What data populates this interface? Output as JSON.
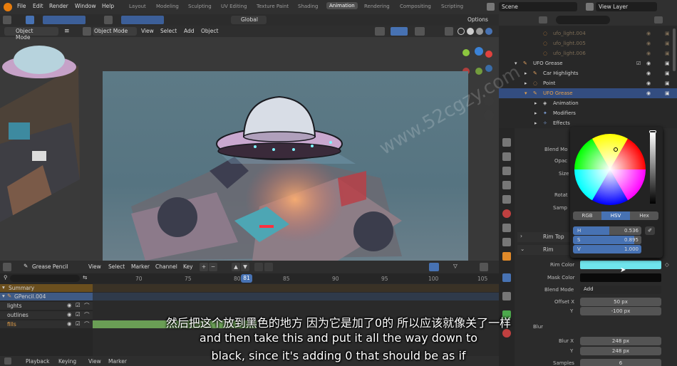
{
  "topbar": {
    "menus": [
      "File",
      "Edit",
      "Render",
      "Window",
      "Help"
    ],
    "workspaces": [
      "Layout",
      "Modeling",
      "Sculpting",
      "UV Editing",
      "Texture Paint",
      "Shading",
      "Animation",
      "Rendering",
      "Compositing",
      "Scripting"
    ],
    "active_workspace": "Animation",
    "scene": "Scene",
    "view_layer": "View Layer"
  },
  "left_panel": {
    "mode": "Object Mode"
  },
  "viewport_header": {
    "mode": "Object Mode",
    "menus": [
      "View",
      "Select",
      "Add",
      "Object"
    ],
    "transform": "Global",
    "options": "Options"
  },
  "outliner": {
    "rows": [
      {
        "label": "ufo_light.004",
        "muted": true
      },
      {
        "label": "ufo_light.005",
        "muted": true
      },
      {
        "label": "ufo_light.006",
        "muted": true
      },
      {
        "label": "UFO Grease",
        "muted": false
      },
      {
        "label": "Car Highlights",
        "muted": false
      },
      {
        "label": "Point",
        "muted": false
      },
      {
        "label": "UFO Grease",
        "muted": false,
        "selected": true
      },
      {
        "label": "Animation",
        "muted": false
      },
      {
        "label": "Modifiers",
        "muted": false
      },
      {
        "label": "Effects",
        "muted": false
      }
    ]
  },
  "properties": {
    "labels": [
      "Blend Mo",
      "Opac",
      "Size",
      "Rotat",
      "Samp"
    ],
    "rim_top": "Rim Top",
    "rim": "Rim",
    "rim_color_label": "Rim Color",
    "mask_color_label": "Mask Color",
    "blend_mode_label": "Blend Mode",
    "blend_mode_value": "Add",
    "offset_x_label": "Offset X",
    "offset_x": "50 px",
    "offset_y_label": "Y",
    "offset_y": "-100 px",
    "blur_label": "Blur",
    "blur_x_label": "Blur X",
    "blur_x": "248 px",
    "blur_y_label": "Y",
    "blur_y": "248 px",
    "samples_label": "Samples",
    "samples": "6",
    "rim_color_hex": "#6fe4ec"
  },
  "color_picker": {
    "modes": [
      "RGB",
      "HSV",
      "Hex"
    ],
    "active_mode": "HSV",
    "h_label": "H",
    "h": "0.536",
    "s_label": "S",
    "s": "0.895",
    "v_label": "V",
    "v": "1.000"
  },
  "timeline": {
    "editor": "Grease Pencil",
    "menus": [
      "View",
      "Select",
      "Marker",
      "Channel",
      "Key"
    ],
    "frames": [
      "70",
      "75",
      "80",
      "85",
      "90",
      "95",
      "100",
      "105"
    ],
    "current_frame": "81",
    "channels": [
      {
        "label": "Summary",
        "kind": "summary"
      },
      {
        "label": "GPencil.004",
        "kind": "object"
      },
      {
        "label": "lights",
        "kind": "layer"
      },
      {
        "label": "outlines",
        "kind": "layer"
      },
      {
        "label": "fills",
        "kind": "layer-active"
      }
    ],
    "footer": [
      "Playback",
      "Keying",
      "View",
      "Marker"
    ]
  },
  "subtitles": {
    "zh": "然后把这个放到黑色的地方 因为它是加了0的 所以应该就像关了一样",
    "en1": "and then take this and put it all the way down to",
    "en2": "black, since it's adding 0 that should be as if"
  },
  "watermark": "www.52cgzy.com"
}
